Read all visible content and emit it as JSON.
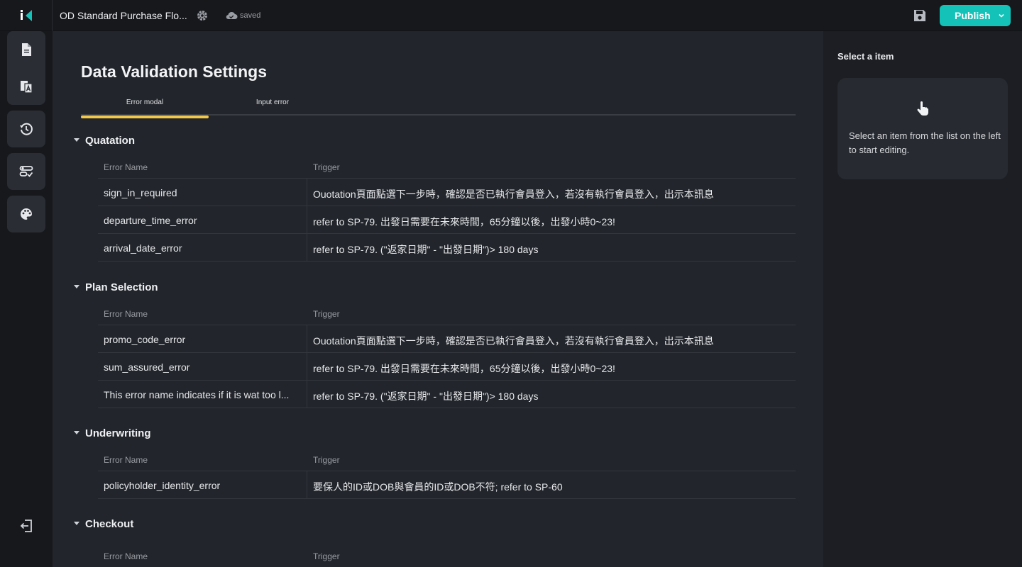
{
  "header": {
    "doc_title": "OD Standard Purchase Flo...",
    "save_status": "saved",
    "publish_label": "Publish"
  },
  "sidebar": {
    "items": [
      {
        "icon": "document-icon"
      },
      {
        "icon": "translate-icon"
      },
      {
        "icon": "history-icon"
      },
      {
        "icon": "validation-settings-icon"
      },
      {
        "icon": "palette-icon"
      }
    ],
    "exit_icon": "exit-icon"
  },
  "main": {
    "title": "Data Validation Settings",
    "tabs": [
      {
        "label": "Error modal",
        "active": true
      },
      {
        "label": "Input error",
        "active": false
      }
    ],
    "columns": {
      "name": "Error Name",
      "trigger": "Trigger"
    },
    "sections": [
      {
        "title": "Quatation",
        "rows": [
          {
            "name": "sign_in_required",
            "trigger": "Ouotation頁面點選下一步時，確認是否已執行會員登入，若沒有執行會員登入，出示本訊息"
          },
          {
            "name": "departure_time_error",
            "trigger": "refer to SP-79.  出發日需要在未來時間，65分鐘以後，出發小時0~23!"
          },
          {
            "name": "arrival_date_error",
            "trigger": "refer to SP-79. (\"返家日期\" - \"出發日期\")> 180 days"
          }
        ]
      },
      {
        "title": "Plan Selection",
        "rows": [
          {
            "name": "promo_code_error",
            "trigger": "Ouotation頁面點選下一步時，確認是否已執行會員登入，若沒有執行會員登入，出示本訊息"
          },
          {
            "name": "sum_assured_error",
            "trigger": "refer to SP-79.  出發日需要在未來時間，65分鐘以後，出發小時0~23!"
          },
          {
            "name": "This error name indicates if it is wat too l...",
            "trigger": "refer to SP-79. (\"返家日期\" - \"出發日期\")> 180 days"
          }
        ]
      },
      {
        "title": "Underwriting",
        "rows": [
          {
            "name": "policyholder_identity_error",
            "trigger": "要保人的ID或DOB與會員的ID或DOB不符; refer to SP-60"
          }
        ]
      },
      {
        "title": "Checkout",
        "rows": []
      }
    ]
  },
  "right_panel": {
    "title": "Select a item",
    "hint": "Select an item from the list on the left to start editing."
  },
  "colors": {
    "accent": "#14c2b8",
    "tab_indicator": "#f2c84b"
  }
}
